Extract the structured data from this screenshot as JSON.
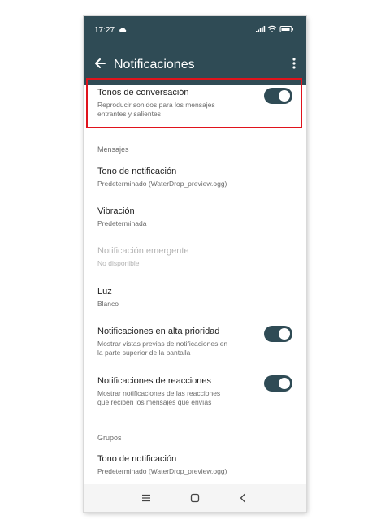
{
  "status_bar": {
    "time": "17:27",
    "icons": [
      "cloud-icon",
      "signal-icon",
      "wifi-icon",
      "battery-icon"
    ]
  },
  "app_bar": {
    "title": "Notificaciones",
    "icons": [
      "back-arrow-icon",
      "overflow-menu-icon"
    ]
  },
  "conversation_tones": {
    "title": "Tonos de conversación",
    "subtitle_line1": "Reproducir sonidos para los mensajes",
    "subtitle_line2": "entrantes y salientes",
    "enabled": true
  },
  "messages_section": {
    "header": "Mensajes",
    "notification_tone": {
      "title": "Tono de notificación",
      "value": "Predeterminado (WaterDrop_preview.ogg)"
    },
    "vibration": {
      "title": "Vibración",
      "value": "Predeterminada"
    },
    "popup": {
      "title": "Notificación emergente",
      "value": "No disponible"
    },
    "light": {
      "title": "Luz",
      "value": "Blanco"
    },
    "high_priority": {
      "title": "Notificaciones en alta prioridad",
      "subtitle_line1": "Mostrar vistas previas de notificaciones en",
      "subtitle_line2": "la parte superior de la pantalla",
      "enabled": true
    },
    "reactions": {
      "title": "Notificaciones de reacciones",
      "subtitle_line1": "Mostrar notificaciones de las reacciones",
      "subtitle_line2": "que reciben los mensajes que envías",
      "enabled": true
    }
  },
  "groups_section": {
    "header": "Grupos",
    "notification_tone": {
      "title": "Tono de notificación",
      "value": "Predeterminado (WaterDrop_preview.ogg)"
    }
  },
  "nav_bar": {
    "icons": [
      "recents-icon",
      "home-icon",
      "back-icon"
    ]
  },
  "colors": {
    "primary": "#2f4b55",
    "highlight": "#e0131c"
  }
}
